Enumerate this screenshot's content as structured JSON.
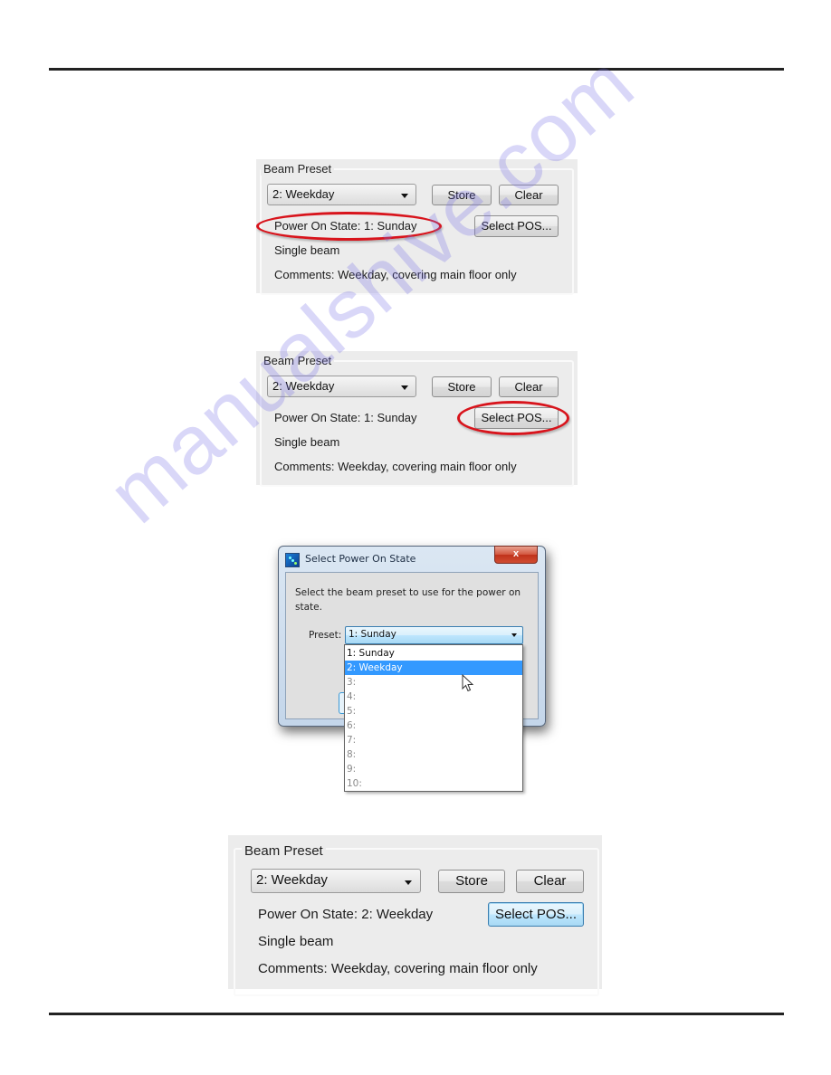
{
  "watermark": "manualshive.com",
  "panels": [
    {
      "group_label": "Beam Preset",
      "preset_value": "2: Weekday",
      "store_label": "Store",
      "clear_label": "Clear",
      "pos_text": "Power On State:  1: Sunday",
      "select_pos_label": "Select POS...",
      "beam_text": "Single beam",
      "comments_text": "Comments:  Weekday,  covering main floor only",
      "highlight": "power-on-state"
    },
    {
      "group_label": "Beam Preset",
      "preset_value": "2: Weekday",
      "store_label": "Store",
      "clear_label": "Clear",
      "pos_text": "Power On State:  1: Sunday",
      "select_pos_label": "Select POS...",
      "beam_text": "Single beam",
      "comments_text": "Comments:  Weekday,  covering main floor only",
      "highlight": "select-pos-button"
    },
    {
      "group_label": "Beam Preset",
      "preset_value": "2: Weekday",
      "store_label": "Store",
      "clear_label": "Clear",
      "pos_text": "Power On State:  2: Weekday",
      "select_pos_label": "Select POS...",
      "beam_text": "Single beam",
      "comments_text": "Comments:  Weekday,  covering main floor only",
      "highlight": "none"
    }
  ],
  "dialog": {
    "title": "Select Power On State",
    "close_glyph": "x",
    "message": "Select the beam preset to use for the power on state.",
    "preset_label": "Preset:",
    "preset_value": "1: Sunday",
    "options": [
      {
        "label": "1: Sunday",
        "enabled": true,
        "selected": false
      },
      {
        "label": "2: Weekday",
        "enabled": true,
        "selected": true
      },
      {
        "label": "3:",
        "enabled": false,
        "selected": false
      },
      {
        "label": "4:",
        "enabled": false,
        "selected": false
      },
      {
        "label": "5:",
        "enabled": false,
        "selected": false
      },
      {
        "label": "6:",
        "enabled": false,
        "selected": false
      },
      {
        "label": "7:",
        "enabled": false,
        "selected": false
      },
      {
        "label": "8:",
        "enabled": false,
        "selected": false
      },
      {
        "label": "9:",
        "enabled": false,
        "selected": false
      },
      {
        "label": "10:",
        "enabled": false,
        "selected": false
      }
    ]
  },
  "colors": {
    "highlight_ellipse": "#d8141c",
    "selected_row": "#3399ff",
    "panel_bg": "#ececec"
  }
}
